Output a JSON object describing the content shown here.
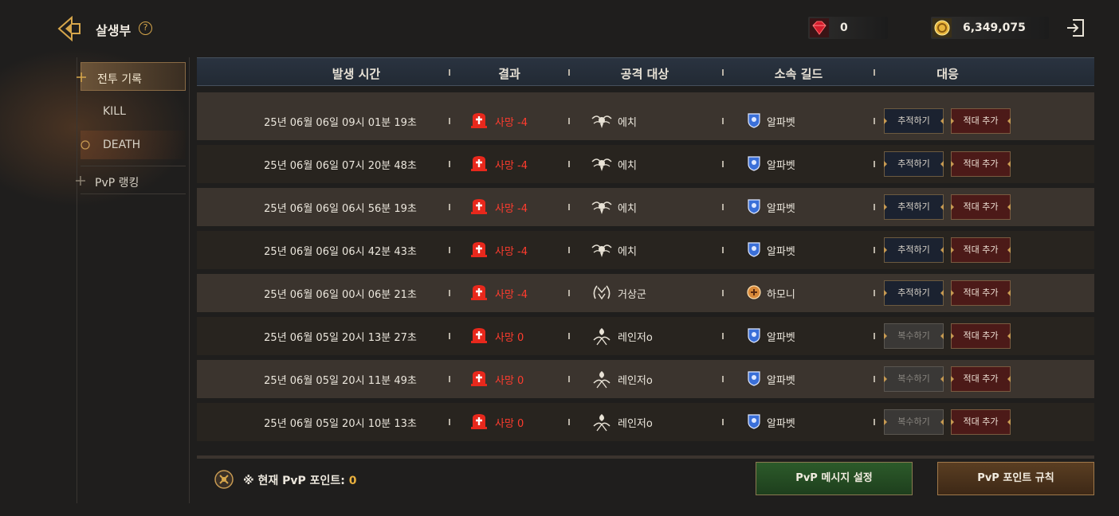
{
  "header": {
    "title": "살생부",
    "help_label": "?",
    "gems": "0",
    "gold": "6,349,075"
  },
  "sidebar": {
    "items": [
      {
        "label": "전투 기록",
        "state": "active"
      },
      {
        "label": "KILL",
        "state": "sub"
      },
      {
        "label": "DEATH",
        "state": "sub-active"
      },
      {
        "label": "PvP 랭킹",
        "state": "main"
      }
    ]
  },
  "table": {
    "columns": [
      "발생 시간",
      "결과",
      "공격 대상",
      "소속 길드",
      "대응"
    ],
    "rows": [
      {
        "time": "25년 06월 06일 09시 01분 19초",
        "result": "사망 -4",
        "target": "에치",
        "target_emblem": "winged-skull",
        "guild": "알파벳",
        "guild_emblem": "blue-shield",
        "action": "추적하기",
        "action_type": "track",
        "enemy": "적대 추가"
      },
      {
        "time": "25년 06월 06일 07시 20분 48초",
        "result": "사망 -4",
        "target": "에치",
        "target_emblem": "winged-skull",
        "guild": "알파벳",
        "guild_emblem": "blue-shield",
        "action": "추적하기",
        "action_type": "track",
        "enemy": "적대 추가"
      },
      {
        "time": "25년 06월 06일 06시 56분 19초",
        "result": "사망 -4",
        "target": "에치",
        "target_emblem": "winged-skull",
        "guild": "알파벳",
        "guild_emblem": "blue-shield",
        "action": "추적하기",
        "action_type": "track",
        "enemy": "적대 추가"
      },
      {
        "time": "25년 06월 06일 06시 42분 43초",
        "result": "사망 -4",
        "target": "에치",
        "target_emblem": "winged-skull",
        "guild": "알파벳",
        "guild_emblem": "blue-shield",
        "action": "추적하기",
        "action_type": "track",
        "enemy": "적대 추가"
      },
      {
        "time": "25년 06월 06일 00시 06분 21초",
        "result": "사망 -4",
        "target": "거상군",
        "target_emblem": "wreath",
        "guild": "하모니",
        "guild_emblem": "orange-crest",
        "action": "추적하기",
        "action_type": "track",
        "enemy": "적대 추가"
      },
      {
        "time": "25년 06월 05일 20시 13분 27초",
        "result": "사망 0",
        "target": "레인저o",
        "target_emblem": "spirit",
        "guild": "알파벳",
        "guild_emblem": "blue-shield",
        "action": "복수하기",
        "action_type": "revenge",
        "enemy": "적대 추가"
      },
      {
        "time": "25년 06월 05일 20시 11분 49초",
        "result": "사망 0",
        "target": "레인저o",
        "target_emblem": "spirit",
        "guild": "알파벳",
        "guild_emblem": "blue-shield",
        "action": "복수하기",
        "action_type": "revenge",
        "enemy": "적대 추가"
      },
      {
        "time": "25년 06월 05일 20시 10분 13초",
        "result": "사망 0",
        "target": "레인저o",
        "target_emblem": "spirit",
        "guild": "알파벳",
        "guild_emblem": "blue-shield",
        "action": "복수하기",
        "action_type": "revenge",
        "enemy": "적대 추가"
      }
    ]
  },
  "footer": {
    "points_label": "※ 현재 PvP 포인트: ",
    "points_value": "0",
    "message_button": "PvP 메시지 설정",
    "rules_button": "PvP 포인트 규칙"
  },
  "colors": {
    "accent_gold": "#d6a64b",
    "death_red": "#ff3c2e",
    "enemy_button": "#4c1a18",
    "message_button": "#2c5a2a"
  }
}
